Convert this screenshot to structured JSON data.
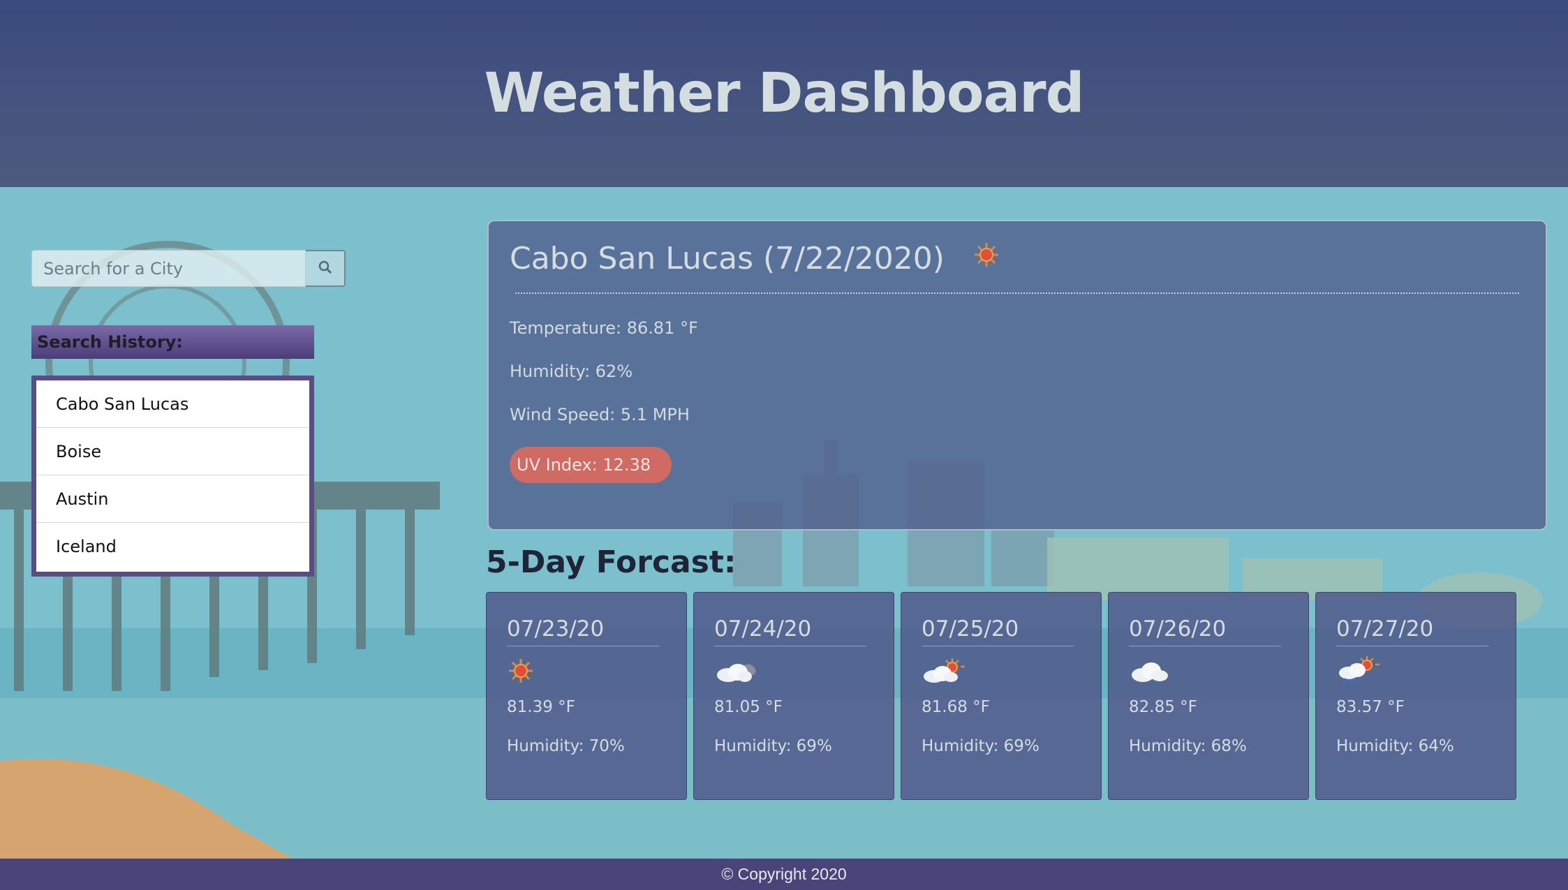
{
  "header": {
    "title": "Weather Dashboard"
  },
  "search": {
    "placeholder": "Search for a City",
    "button_icon": "search-icon"
  },
  "history": {
    "title": "Search History:",
    "items": [
      "Cabo San Lucas",
      "Boise",
      "Austin",
      "Iceland"
    ]
  },
  "current": {
    "title": "Cabo San Lucas (7/22/2020)",
    "icon": "sun-icon",
    "temperature": "Temperature: 86.81 °F",
    "humidity": "Humidity: 62%",
    "wind": "Wind Speed: 5.1 MPH",
    "uv": "UV Index: 12.38",
    "uv_color": "#cf6b63"
  },
  "forecast": {
    "title": "5-Day Forcast:",
    "days": [
      {
        "date": "07/23/20",
        "icon": "sun-icon",
        "temp": "81.39 °F",
        "humidity": "Humidity: 70%"
      },
      {
        "date": "07/24/20",
        "icon": "cloud-icon",
        "temp": "81.05 °F",
        "humidity": "Humidity: 69%"
      },
      {
        "date": "07/25/20",
        "icon": "partly-sunny-icon",
        "temp": "81.68 °F",
        "humidity": "Humidity: 69%"
      },
      {
        "date": "07/26/20",
        "icon": "cloud-icon",
        "temp": "82.85 °F",
        "humidity": "Humidity: 68%"
      },
      {
        "date": "07/27/20",
        "icon": "rain-sun-icon",
        "temp": "83.57 °F",
        "humidity": "Humidity: 64%"
      }
    ]
  },
  "footer": {
    "text": "© Copyright 2020"
  }
}
